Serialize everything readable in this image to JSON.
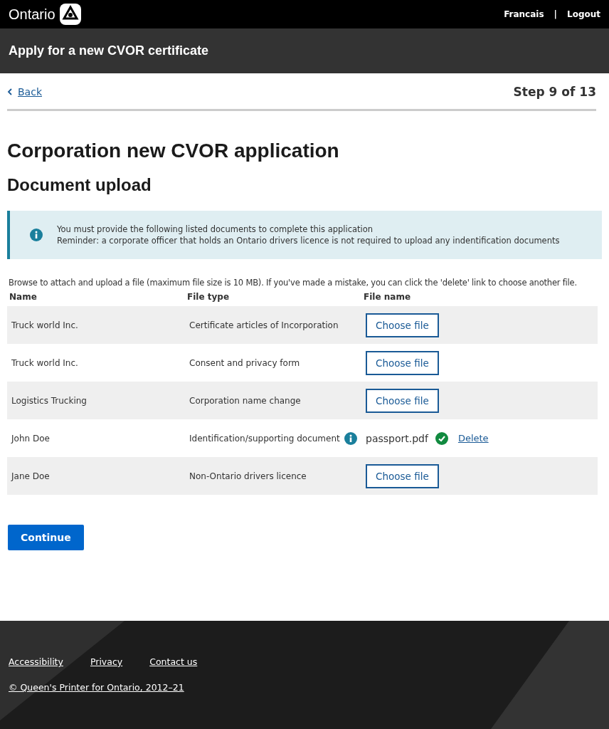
{
  "header": {
    "logo": "Ontario",
    "links": [
      "Francais",
      "Logout"
    ],
    "separator": "|"
  },
  "title_bar": {
    "title": "Apply for a new CVOR certificate"
  },
  "nav": {
    "back": "Back",
    "step": "Step 9 of 13"
  },
  "heading": "Corporation new CVOR application",
  "subheading": "Document upload",
  "notice": {
    "lines": [
      "You must provide the following listed documents to complete this application",
      "Reminder: a corporate officer that holds an Ontario drivers licence is not required to upload any indentification documents"
    ]
  },
  "intro": "Browse to attach and upload a file (maximum file size is 10 MB). If you've made a mistake, you can click the 'delete' link  to choose another file.",
  "table": {
    "columns": [
      "Name",
      "File type",
      "File name"
    ],
    "rows": [
      {
        "name": "Truck world Inc.",
        "file_type": "Certificate articles of Incorporation",
        "kind": "upload",
        "button": "Choose file"
      },
      {
        "name": "Truck world Inc.",
        "file_type": "Consent and privacy form",
        "kind": "upload",
        "button": "Choose file"
      },
      {
        "name": "Logistics Trucking",
        "file_type": "Corporation name change",
        "kind": "upload",
        "button": "Choose file"
      },
      {
        "name": "John Doe",
        "file_type": "Identification/supporting document",
        "info": true,
        "kind": "uploaded",
        "file": "passport.pdf",
        "delete": "Delete"
      },
      {
        "name": "Jane Doe",
        "file_type": "Non-Ontario drivers licence",
        "kind": "upload",
        "button": "Choose file"
      }
    ]
  },
  "continue": "Continue",
  "footer": {
    "links": [
      "Accessibility",
      "Privacy",
      "Contact us"
    ],
    "copyright": "© Queen's Printer for Ontario, 2012–21"
  }
}
